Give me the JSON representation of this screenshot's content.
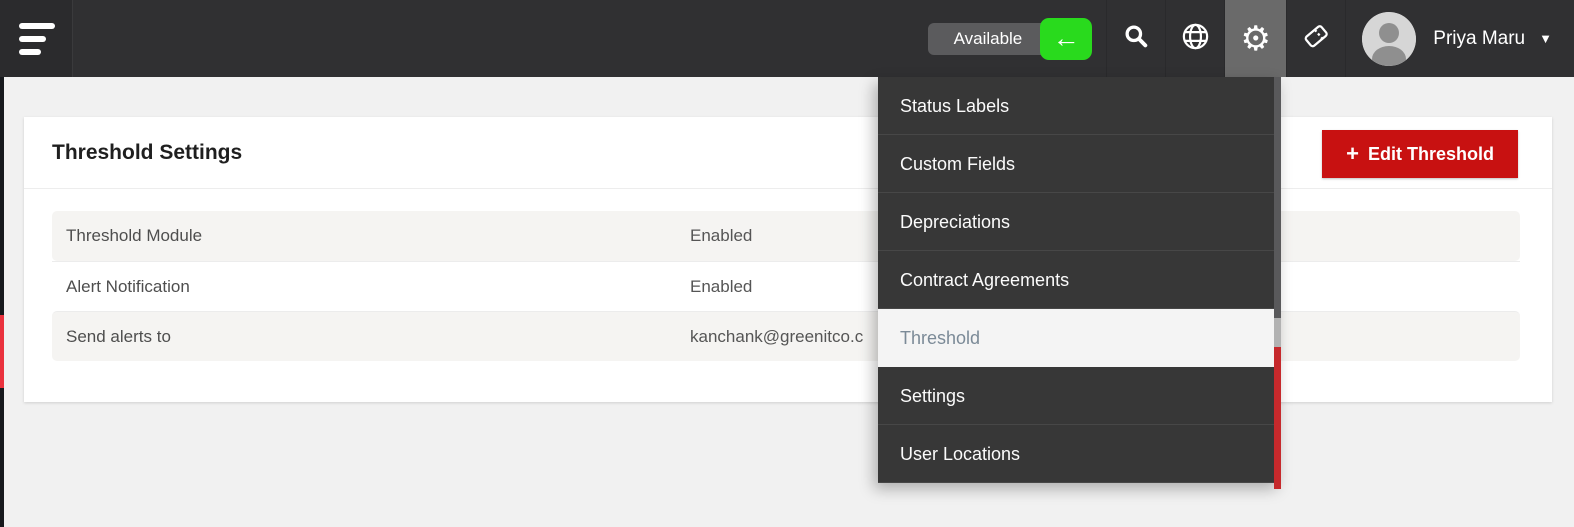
{
  "navbar": {
    "available_label": "Available",
    "user_name": "Priya Maru"
  },
  "icons": {
    "back_arrow": "←",
    "gear": "⚙",
    "caret_down": "▼",
    "plus": "+"
  },
  "settings_menu": {
    "items": [
      {
        "label": "Status Labels",
        "active": false
      },
      {
        "label": "Custom Fields",
        "active": false
      },
      {
        "label": "Depreciations",
        "active": false
      },
      {
        "label": "Contract Agreements",
        "active": false
      },
      {
        "label": "Threshold",
        "active": true
      },
      {
        "label": "Settings",
        "active": false
      },
      {
        "label": "User Locations",
        "active": false
      }
    ]
  },
  "page": {
    "title": "Threshold Settings",
    "edit_button_label": "Edit Threshold",
    "rows": [
      {
        "label": "Threshold Module",
        "value": "Enabled"
      },
      {
        "label": "Alert Notification",
        "value": "Enabled"
      },
      {
        "label": "Send alerts to",
        "value": "kanchank@greenitco.c"
      }
    ]
  },
  "colors": {
    "navbar_bg": "#303032",
    "accent_green": "#29da1d",
    "accent_red_button": "#c81111",
    "dropdown_bg": "#373737",
    "active_item_bg": "#f4f4f4",
    "active_item_text": "#7b8a97",
    "scrollbar_red": "#c6292c",
    "edge_red": "#ea323e",
    "page_bg": "#f1f1f1"
  }
}
